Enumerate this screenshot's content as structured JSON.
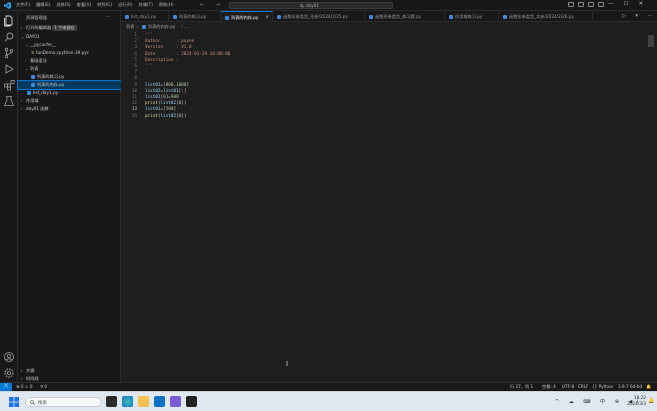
{
  "titlebar": {
    "menu": [
      "文件(F)",
      "编辑(E)",
      "选择(S)",
      "查看(V)",
      "转到(G)",
      "运行(R)",
      "终端(T)",
      "帮助(H)"
    ],
    "search": "day01",
    "nav_arrows": "← →",
    "win_controls": [
      "—",
      "☐",
      "✕"
    ]
  },
  "sidebar": {
    "header": "资源管理器",
    "more": "···",
    "rows": [
      {
        "label": "打开的编辑器",
        "badge": "1 个未保存"
      },
      {
        "label": "DAY01"
      },
      {
        "label": "__pycache__"
      },
      {
        "label": "funDemo.cpython-39.pyc"
      },
      {
        "label": "基础语法"
      },
      {
        "label": "列表"
      },
      {
        "label": "列表的练习.py"
      },
      {
        "label": "列表的内存.py"
      },
      {
        "label": "list_day1.py"
      },
      {
        "label": "作用域"
      },
      {
        "label": "day01 函数"
      }
    ],
    "bottom": [
      "大纲",
      "时间线"
    ]
  },
  "tabs": [
    {
      "label": "list_day1.py",
      "active": false
    },
    {
      "label": "列表的练习.py",
      "active": false
    },
    {
      "label": "列表的内存.py",
      "active": true
    },
    {
      "label": "函数形参类型_形参/2024/2/25.py",
      "active": false
    },
    {
      "label": "函数形参类型_练习题.py",
      "active": false
    },
    {
      "label": "作用域练习.py",
      "active": false
    },
    {
      "label": "函数形参类型_实参/2024/2/26.py",
      "active": false
    }
  ],
  "editor_actions": "▷ ▾ ⋯",
  "breadcrumb": [
    "列表",
    "›",
    "列表的内存.py",
    "›",
    "..."
  ],
  "editor": {
    "current_line": 13,
    "lines": [
      [
        {
          "t": "'''",
          "c": "str"
        }
      ],
      [
        {
          "t": "Author      : payne",
          "c": "str"
        }
      ],
      [
        {
          "t": "Version     : V1.0",
          "c": "str"
        }
      ],
      [
        {
          "t": "Date        : 2024-01-29 10:00:00",
          "c": "str"
        }
      ],
      [
        {
          "t": "Description :",
          "c": "str"
        }
      ],
      [
        {
          "t": "'''",
          "c": "str"
        }
      ],
      [],
      [],
      [
        {
          "t": "list01",
          "c": "var"
        },
        {
          "t": "=",
          "c": "op"
        },
        {
          "t": "[",
          "c": "op"
        },
        {
          "t": "800",
          "c": "num"
        },
        {
          "t": ",",
          "c": "op"
        },
        {
          "t": "1000",
          "c": "num"
        },
        {
          "t": "]",
          "c": "op"
        }
      ],
      [
        {
          "t": "list02",
          "c": "var"
        },
        {
          "t": "=",
          "c": "op"
        },
        {
          "t": "list01",
          "c": "var"
        },
        {
          "t": "[:]",
          "c": "op"
        }
      ],
      [
        {
          "t": "list01",
          "c": "var"
        },
        {
          "t": "[",
          "c": "op"
        },
        {
          "t": "0",
          "c": "num"
        },
        {
          "t": "]=",
          "c": "op"
        },
        {
          "t": "900",
          "c": "num"
        }
      ],
      [
        {
          "t": "print",
          "c": "fn"
        },
        {
          "t": "(",
          "c": "op"
        },
        {
          "t": "list02",
          "c": "var"
        },
        {
          "t": "[",
          "c": "op"
        },
        {
          "t": "0",
          "c": "num"
        },
        {
          "t": "])",
          "c": "op"
        }
      ],
      [
        {
          "t": "list01",
          "c": "var"
        },
        {
          "t": "=[",
          "c": "op"
        },
        {
          "t": "500",
          "c": "num"
        },
        {
          "t": "]",
          "c": "op"
        }
      ],
      [
        {
          "t": "print",
          "c": "fn"
        },
        {
          "t": "(",
          "c": "op"
        },
        {
          "t": "list02",
          "c": "var"
        },
        {
          "t": "[",
          "c": "op"
        },
        {
          "t": "0",
          "c": "num"
        },
        {
          "t": "])",
          "c": "op"
        }
      ]
    ]
  },
  "statusbar": {
    "remote": "⟩⟨",
    "problems": "⊗ 0 ⚠ 0",
    "ports": "⚲ 0",
    "cursor": "行 17，列 1",
    "spaces": "空格: 4",
    "encoding": "UTF-8",
    "eol": "CRLF",
    "language": "{} Python",
    "interpreter": "3.9.7 64-bit",
    "bell": "🔔"
  },
  "taskbar": {
    "search_placeholder": "搜索",
    "tray": "^ ☁ ⌨ 中 ⊕ ◀)",
    "time": "18:22",
    "date": "2024/3/3",
    "bell": "🔔"
  },
  "colors": {
    "accent": "#0078d4",
    "editor_bg": "#1e1e1e",
    "string": "#ce9178",
    "number": "#b5cea8",
    "variable": "#9cdcfe",
    "function": "#dcdcaa"
  }
}
